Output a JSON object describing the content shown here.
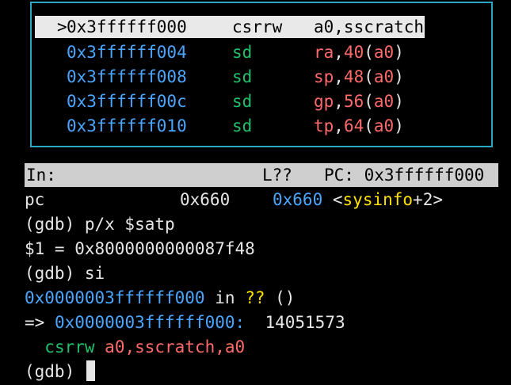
{
  "disassembly": {
    "lines": [
      {
        "marker": ">",
        "address": "0x3ffffff000",
        "mnemonic": "csrrw",
        "operands": "a0,sscratch,a0",
        "current": true
      },
      {
        "marker": "",
        "address": "0x3ffffff004",
        "mnemonic": "sd",
        "reg": "ra",
        "offset": "40",
        "base": "a0",
        "current": false
      },
      {
        "marker": "",
        "address": "0x3ffffff008",
        "mnemonic": "sd",
        "reg": "sp",
        "offset": "48",
        "base": "a0",
        "current": false
      },
      {
        "marker": "",
        "address": "0x3ffffff00c",
        "mnemonic": "sd",
        "reg": "gp",
        "offset": "56",
        "base": "a0",
        "current": false
      },
      {
        "marker": "",
        "address": "0x3ffffff010",
        "mnemonic": "sd",
        "reg": "tp",
        "offset": "64",
        "base": "a0",
        "current": false
      }
    ]
  },
  "status_bar": {
    "in_label": "In:",
    "line_label": "L??",
    "pc_label": "PC: 0x3ffffff000"
  },
  "console": {
    "pc_row": {
      "reg": "pc",
      "hex": "0x660",
      "addr": "0x660",
      "lt": "<",
      "symbol": "sysinfo",
      "offset": "+2",
      "gt": ">"
    },
    "cmd1": "(gdb) p/x $satp",
    "result1": "$1 = 0x8000000000087f48",
    "cmd2": "(gdb) si",
    "frame_row": {
      "addr": "0x0000003ffffff000",
      "in": "in",
      "func": "??",
      "args": "()"
    },
    "arrow_row": {
      "arrow": "=>",
      "addr": "0x0000003ffffff000:",
      "encoding": "14051573"
    },
    "insn_row": {
      "mnemonic": "csrrw",
      "operands": "a0,sscratch,a0"
    },
    "prompt": "(gdb)"
  },
  "colors": {
    "address": "#4aa6ff",
    "mnemonic": "#20c06a",
    "register": "#ff6b6b",
    "symbol": "#ffe100",
    "border": "#2aa7c5"
  }
}
